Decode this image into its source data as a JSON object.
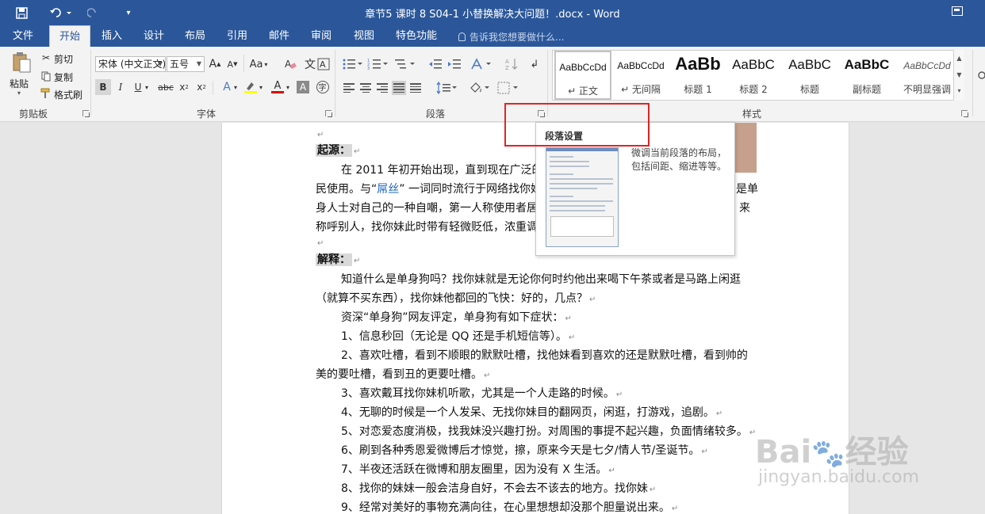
{
  "window": {
    "title": "章节5 课时 8 S04-1 小替换解决大问题！.docx - Word"
  },
  "tabs": [
    "文件",
    "开始",
    "插入",
    "设计",
    "布局",
    "引用",
    "邮件",
    "审阅",
    "视图",
    "特色功能"
  ],
  "tell_me": "告诉我您想要做什么...",
  "clipboard": {
    "paste": "粘贴",
    "cut": "剪切",
    "copy": "复制",
    "format_painter": "格式刷",
    "group": "剪贴板"
  },
  "font": {
    "name": "宋体 (中文正文)",
    "size": "五号",
    "change_case": "Aa",
    "group": "字体"
  },
  "paragraph": {
    "group": "段落"
  },
  "styles": {
    "group": "样式",
    "items": [
      {
        "sample": "AaBbCcDd",
        "name": "↵ 正文"
      },
      {
        "sample": "AaBbCcDd",
        "name": "↵ 无间隔"
      },
      {
        "sample": "AaBb",
        "name": "标题 1"
      },
      {
        "sample": "AaBbC",
        "name": "标题 2"
      },
      {
        "sample": "AaBbC",
        "name": "标题"
      },
      {
        "sample": "AaBbC",
        "name": "副标题"
      },
      {
        "sample": "AaBbCcDd",
        "name": "不明显强调"
      }
    ]
  },
  "tooltip": {
    "title": "段落设置",
    "description": "微调当前段落的布局，包括间距、缩进等等。"
  },
  "document": {
    "heading_origin": "起源：",
    "origin_lines": [
      "在 2011 年初开始出现，直到现在广泛的",
      "民使用。与“",
      "屌丝",
      "” 一词同时流行于网络找你妹",
      "身人士对自己的一种自嘲，第一人称使用者居",
      "称呼别人，找你妹此时带有轻微贬低，浓重调"
    ],
    "origin_right_fragments": [
      "是单",
      "来"
    ],
    "heading_explain": "解释：",
    "body_lines": [
      "知道什么是单身狗吗？找你妹就是无论你何时约他出来喝下午茶或者是马路上闲逛",
      "（就算不买东西），找你妹他都回的飞快：好的，几点？",
      "资深“单身狗”网友评定，单身狗有如下症状：",
      "1、信息秒回（无论是 QQ 还是手机短信等）。",
      "2、喜欢吐槽，看到不顺眼的默默吐槽，找他妹看到喜欢的还是默默吐槽，看到帅的",
      "美的要吐槽，看到丑的更要吐槽。",
      "3、喜欢戴耳找你妹机听歌，尤其是一个人走路的时候。",
      "4、无聊的时候是一个人发呆、无找你妹目的翻网页，闲逛，打游戏，追剧。",
      "5、对恋爱态度消极，找我妹没兴趣打扮。对周围的事提不起兴趣，负面情绪较多。",
      "6、刷到各种秀恩爱微博后才惊觉，擦，原来今天是七夕/情人节/圣诞节。",
      "7、半夜还活跃在微博和朋友圈里，因为没有 X 生活。",
      "8、找你的妹妹一般会洁身自好，不会去不该去的地方。找你妹",
      "9、经常对美好的事物充满向往，在心里想想却没那个胆量说出来。"
    ]
  },
  "watermark": {
    "brand": "Bai",
    "brand2": "经验",
    "url": "jingyan.baidu.com"
  }
}
